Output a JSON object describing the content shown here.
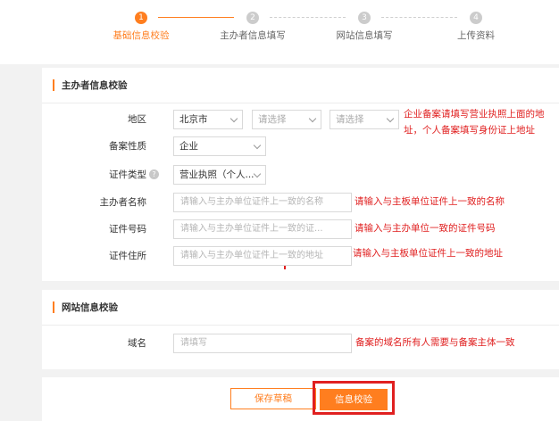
{
  "steps": [
    {
      "num": "1",
      "label": "基础信息校验",
      "active": true
    },
    {
      "num": "2",
      "label": "主办者信息填写",
      "active": false
    },
    {
      "num": "3",
      "label": "网站信息填写",
      "active": false
    },
    {
      "num": "4",
      "label": "上传资料",
      "active": false
    }
  ],
  "sponsor_section": {
    "title": "主办者信息校验",
    "region": {
      "label": "地区",
      "province": "北京市",
      "city_placeholder": "请选择",
      "district_placeholder": "请选择",
      "hint_line1": "企业备案请填写营业执照上面的地",
      "hint_line2": "址，个人备案填写身份证上地址"
    },
    "filing_type": {
      "label": "备案性质",
      "value": "企业"
    },
    "cert_type": {
      "label": "证件类型",
      "help": "?",
      "value": "营业执照（个人..."
    },
    "sponsor_name": {
      "label": "主办者名称",
      "placeholder": "请输入与主办单位证件上一致的名称",
      "hint": "请输入与主板单位证件上一致的名称"
    },
    "cert_number": {
      "label": "证件号码",
      "placeholder": "请输入与主办单位证件上一致的证...",
      "hint": "请输入与主办单位一致的证件号码"
    },
    "cert_address": {
      "label": "证件住所",
      "placeholder": "请输入与主办单位证件上一致的地址",
      "hint": "请输入与主板单位证件上一致的地址"
    }
  },
  "website_section": {
    "title": "网站信息校验",
    "domain": {
      "label": "域名",
      "placeholder": "请填写",
      "hint": "备案的域名所有人需要与备案主体一致"
    }
  },
  "buttons": {
    "save_draft": "保存草稿",
    "verify": "信息校验"
  },
  "colors": {
    "accent": "#ff7e1f",
    "error": "#e02020"
  }
}
